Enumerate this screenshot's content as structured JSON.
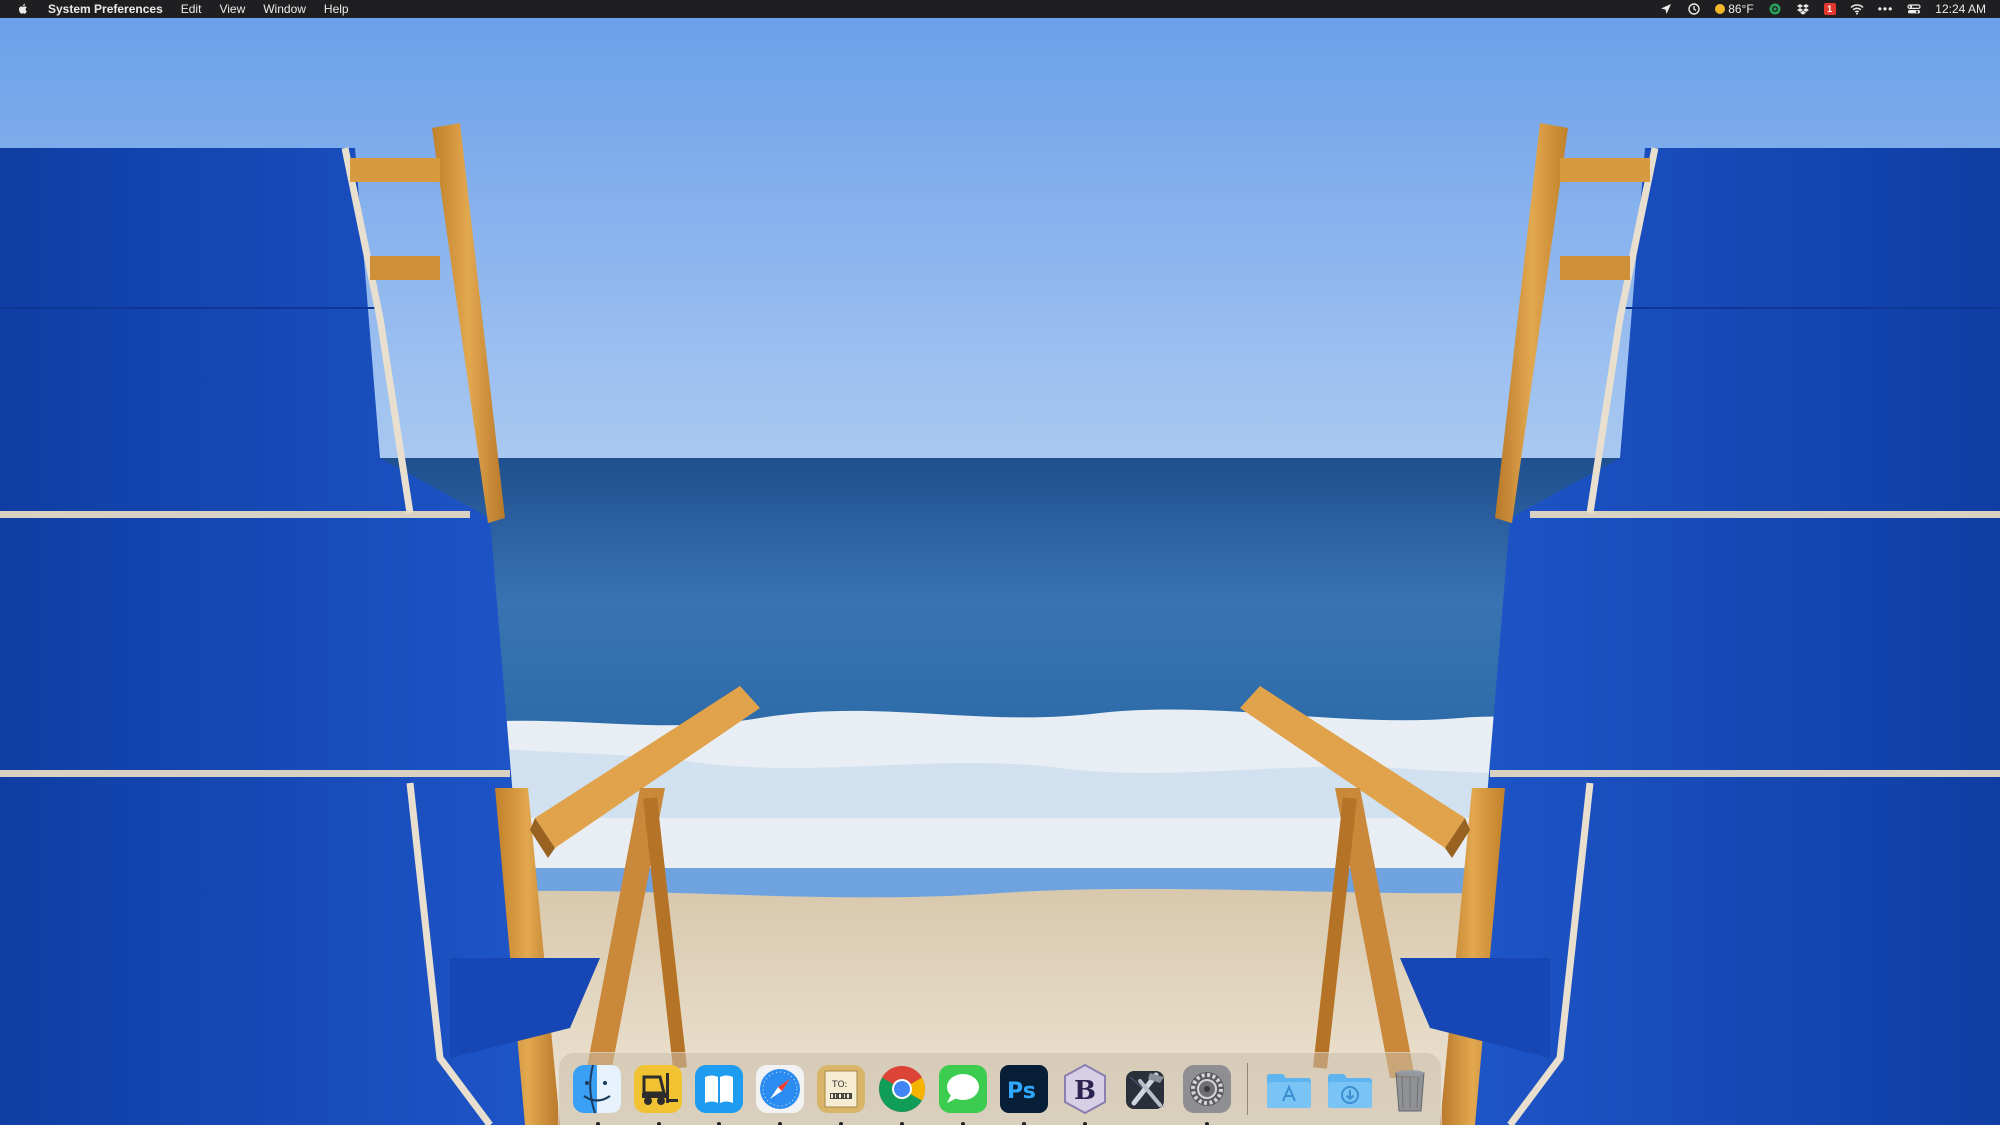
{
  "menubar": {
    "app_name": "System Preferences",
    "menus": [
      "Edit",
      "View",
      "Window",
      "Help"
    ],
    "status": {
      "weather": "86°F",
      "calendar_day": "1",
      "time": "12:24 AM"
    }
  },
  "dock": {
    "apps": [
      {
        "name": "Finder",
        "icon": "finder-icon",
        "running": true
      },
      {
        "name": "Forklift",
        "icon": "forklift-icon",
        "running": true
      },
      {
        "name": "Books",
        "icon": "books-icon",
        "running": true
      },
      {
        "name": "Safari",
        "icon": "safari-icon",
        "running": true
      },
      {
        "name": "Mail To",
        "icon": "mail-to-icon",
        "running": true
      },
      {
        "name": "Chrome",
        "icon": "chrome-icon",
        "running": true
      },
      {
        "name": "Messages",
        "icon": "messages-icon",
        "running": true
      },
      {
        "name": "Photoshop",
        "icon": "photoshop-icon",
        "running": true,
        "label": "Ps"
      },
      {
        "name": "BBEdit",
        "icon": "bbedit-icon",
        "running": true,
        "label": "B"
      },
      {
        "name": "Xcode",
        "icon": "xcode-icon",
        "running": false
      },
      {
        "name": "System Preferences",
        "icon": "gear-icon",
        "running": true
      }
    ],
    "folders": [
      {
        "name": "Applications",
        "icon": "applications-folder-icon"
      },
      {
        "name": "Downloads",
        "icon": "downloads-folder-icon"
      },
      {
        "name": "Trash",
        "icon": "trash-icon"
      }
    ]
  },
  "colors": {
    "menubar_bg": "#1f1f22",
    "sky": "#7fb0ee",
    "ocean": "#2f67a8",
    "chair_canvas": "#1747b5",
    "chair_wood": "#d89a3c",
    "sand": "#e6d9c3"
  }
}
